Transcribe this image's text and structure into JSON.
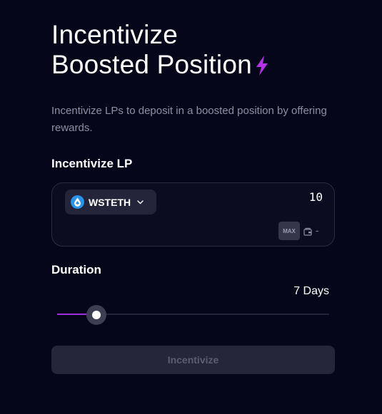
{
  "header": {
    "title_line1": "Incentivize",
    "title_line2": "Boosted Position",
    "title_icon": "lightning-bolt-icon",
    "subtitle": "Incentivize LPs to deposit in a boosted position by offering rewards."
  },
  "incentivize_lp": {
    "label": "Incentivize LP",
    "token": {
      "symbol": "WSTETH",
      "icon": "wsteth-token-icon"
    },
    "amount": "10",
    "max_label": "MAX",
    "wallet_icon": "wallet-icon",
    "balance": "-"
  },
  "duration": {
    "label": "Duration",
    "value_text": "7 Days",
    "slider_fraction": 0.145
  },
  "submit": {
    "label": "Incentivize",
    "disabled": true
  },
  "colors": {
    "background": "#05061a",
    "accent": "#a02fdc",
    "token_blue": "#2a93ea",
    "muted_text": "#8e8fa3"
  }
}
